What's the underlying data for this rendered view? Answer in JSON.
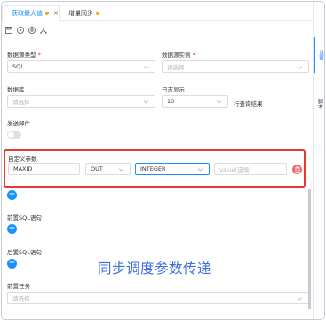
{
  "tabs": [
    {
      "label": "获取最大值",
      "active": true,
      "modified": true
    },
    {
      "label": "增量同步",
      "active": false,
      "modified": true
    }
  ],
  "toolbar": {
    "icons": [
      "save-icon",
      "play-icon",
      "settings-icon",
      "format-icon"
    ]
  },
  "right_panel": {
    "tabs": [
      "设置",
      "脚本"
    ]
  },
  "form": {
    "datasource_type": {
      "label": "数据源类型",
      "value": "SQL"
    },
    "datasource_instance": {
      "label": "数据源实例",
      "placeholder": "请选择"
    },
    "database": {
      "label": "数据库",
      "placeholder": "请选择"
    },
    "log_display": {
      "label": "日志显示",
      "value": "10",
      "suffix": "行查询结果"
    },
    "send_email": {
      "label": "发送邮件",
      "on": false
    },
    "custom_params": {
      "label": "自定义参数",
      "rows": [
        {
          "name": "MAXID",
          "direction": "OUT",
          "type": "INTEGER",
          "value_placeholder": "value(选填)"
        }
      ]
    },
    "pre_sql": {
      "label": "前置SQL语句"
    },
    "post_sql": {
      "label": "后置SQL语句"
    },
    "pre_task": {
      "label": "前置任务",
      "placeholder": "请选择"
    }
  },
  "annotation": {
    "caption": "同步调度参数传递",
    "highlight_color": "#e53935"
  },
  "colors": {
    "accent": "#1890ff",
    "modified_dot": "#f5a623",
    "danger": "#f56c6c",
    "caption": "#3f6fe0"
  }
}
